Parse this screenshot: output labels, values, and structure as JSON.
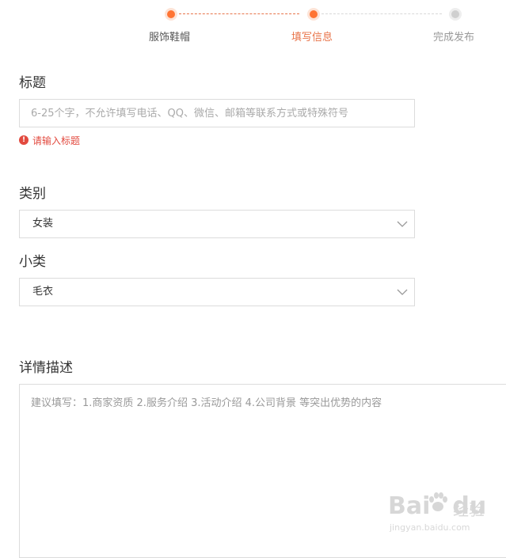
{
  "stepper": {
    "steps": [
      {
        "label": "服饰鞋帽",
        "state": "done"
      },
      {
        "label": "填写信息",
        "state": "active"
      },
      {
        "label": "完成发布",
        "state": "todo"
      }
    ],
    "colors": {
      "active": "#ff7433",
      "todo": "#cfcfcf"
    }
  },
  "title_field": {
    "label": "标题",
    "placeholder": "6-25个字，不允许填写电话、QQ、微信、邮箱等联系方式或特殊符号",
    "value": "",
    "error_icon": "error-circle-icon",
    "error": "请输入标题"
  },
  "category_field": {
    "label": "类别",
    "value": "女装",
    "icon": "chevron-down-icon"
  },
  "subcategory_field": {
    "label": "小类",
    "value": "毛衣",
    "icon": "chevron-down-icon"
  },
  "description_field": {
    "label": "详情描述",
    "placeholder": "建议填写：1.商家资质 2.服务介绍 3.活动介绍 4.公司背景 等突出优势的内容",
    "value": ""
  },
  "watermark": {
    "logo": "Bai",
    "logo_suffix": "du",
    "cn": "经验",
    "url": "jingyan.baidu.com"
  }
}
